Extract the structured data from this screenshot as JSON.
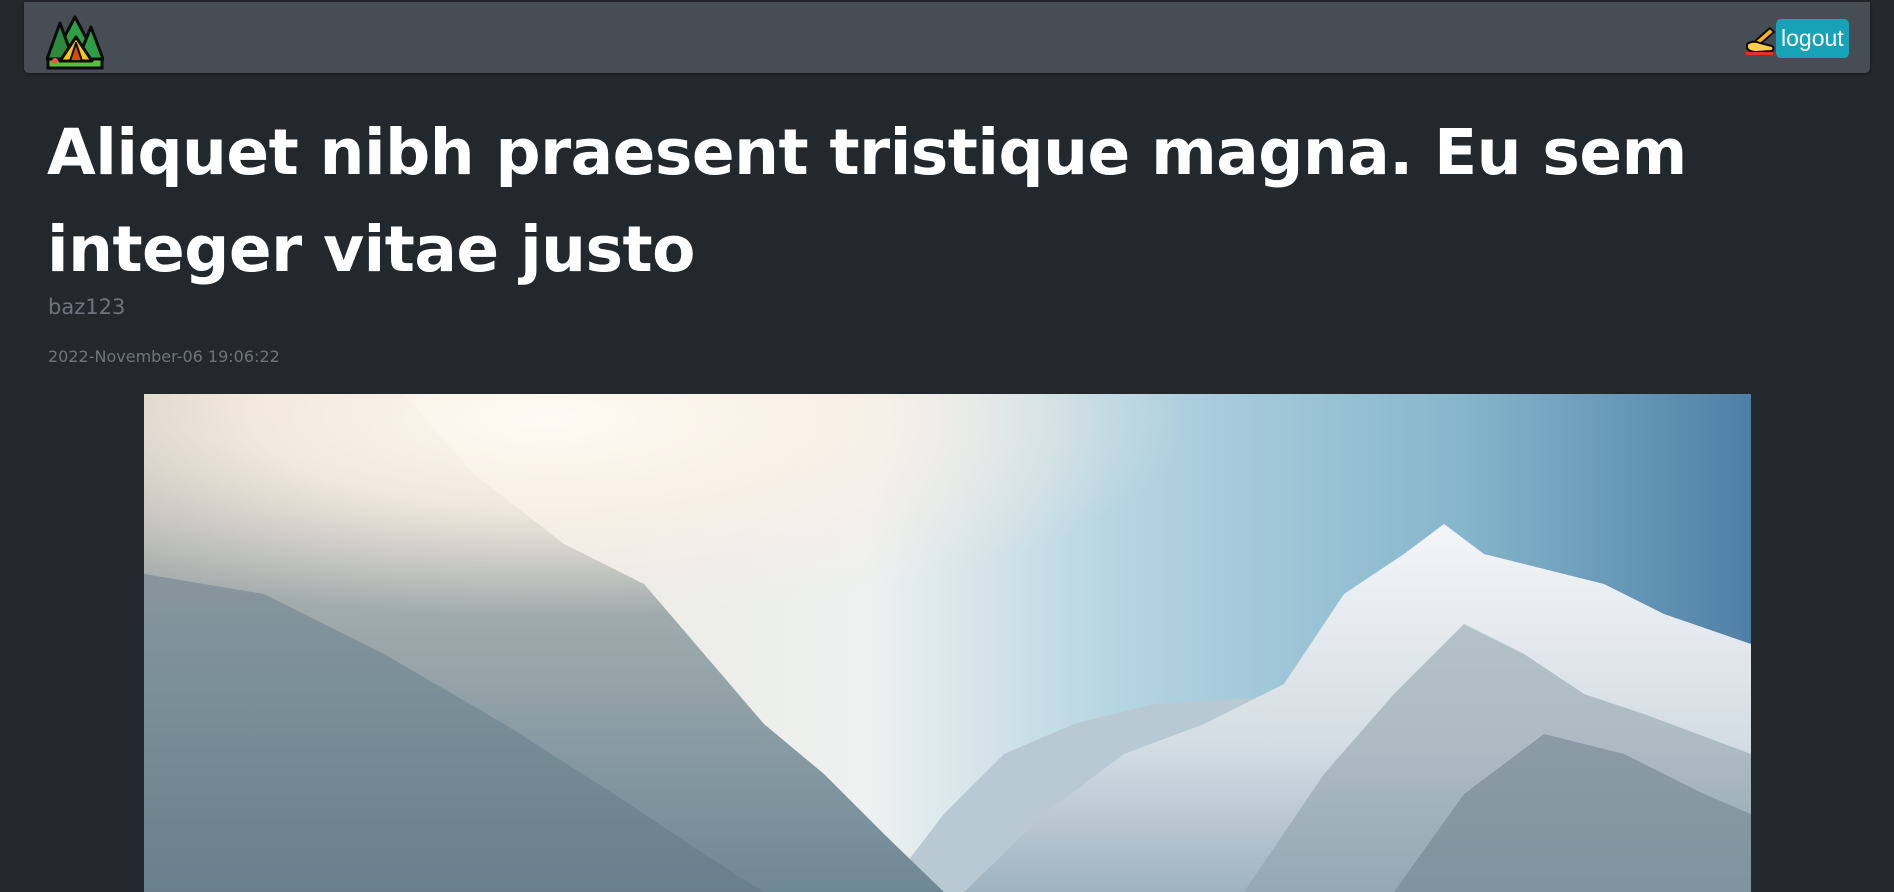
{
  "navbar": {
    "brand_icon": "camping-tent-trees-icon",
    "write_icon": "writing-hand-icon",
    "logout_label": "logout",
    "colors": {
      "navbar_bg": "#474d54",
      "logout_bg": "#17a2b8"
    }
  },
  "post": {
    "title": "Aliquet nibh praesent tristique magna. Eu sem integer vitae justo",
    "author": "baz123",
    "timestamp": "2022-November-06 19:06:22",
    "image": "snowy-mountains-sunlight-photo"
  },
  "colors": {
    "page_bg": "#23282d",
    "title_text": "#ffffff",
    "muted_text": "#6c757d"
  }
}
